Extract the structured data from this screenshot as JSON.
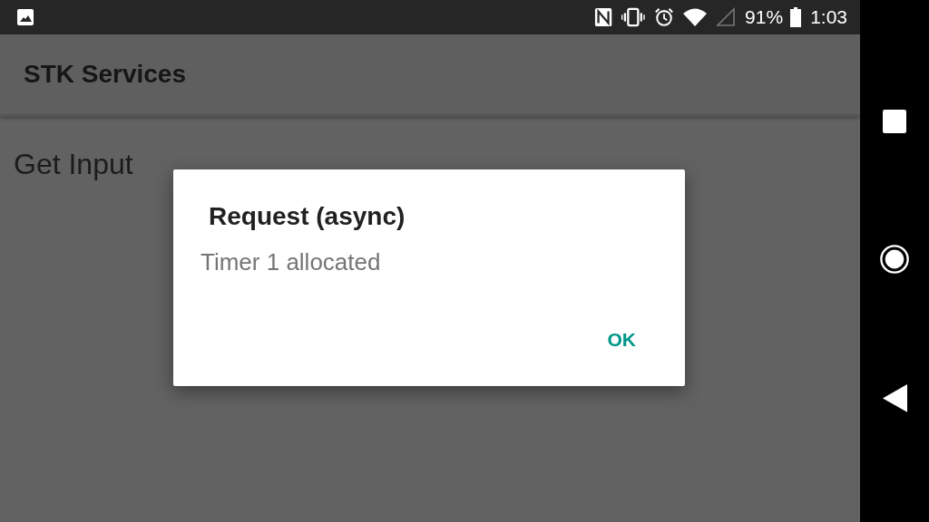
{
  "status_bar": {
    "battery": "91%",
    "time": "1:03"
  },
  "app_bar": {
    "title": "STK Services"
  },
  "content": {
    "heading": "Get Input"
  },
  "dialog": {
    "title": "Request (async)",
    "message": "Timer 1 allocated",
    "buttons": [
      "OK"
    ]
  }
}
